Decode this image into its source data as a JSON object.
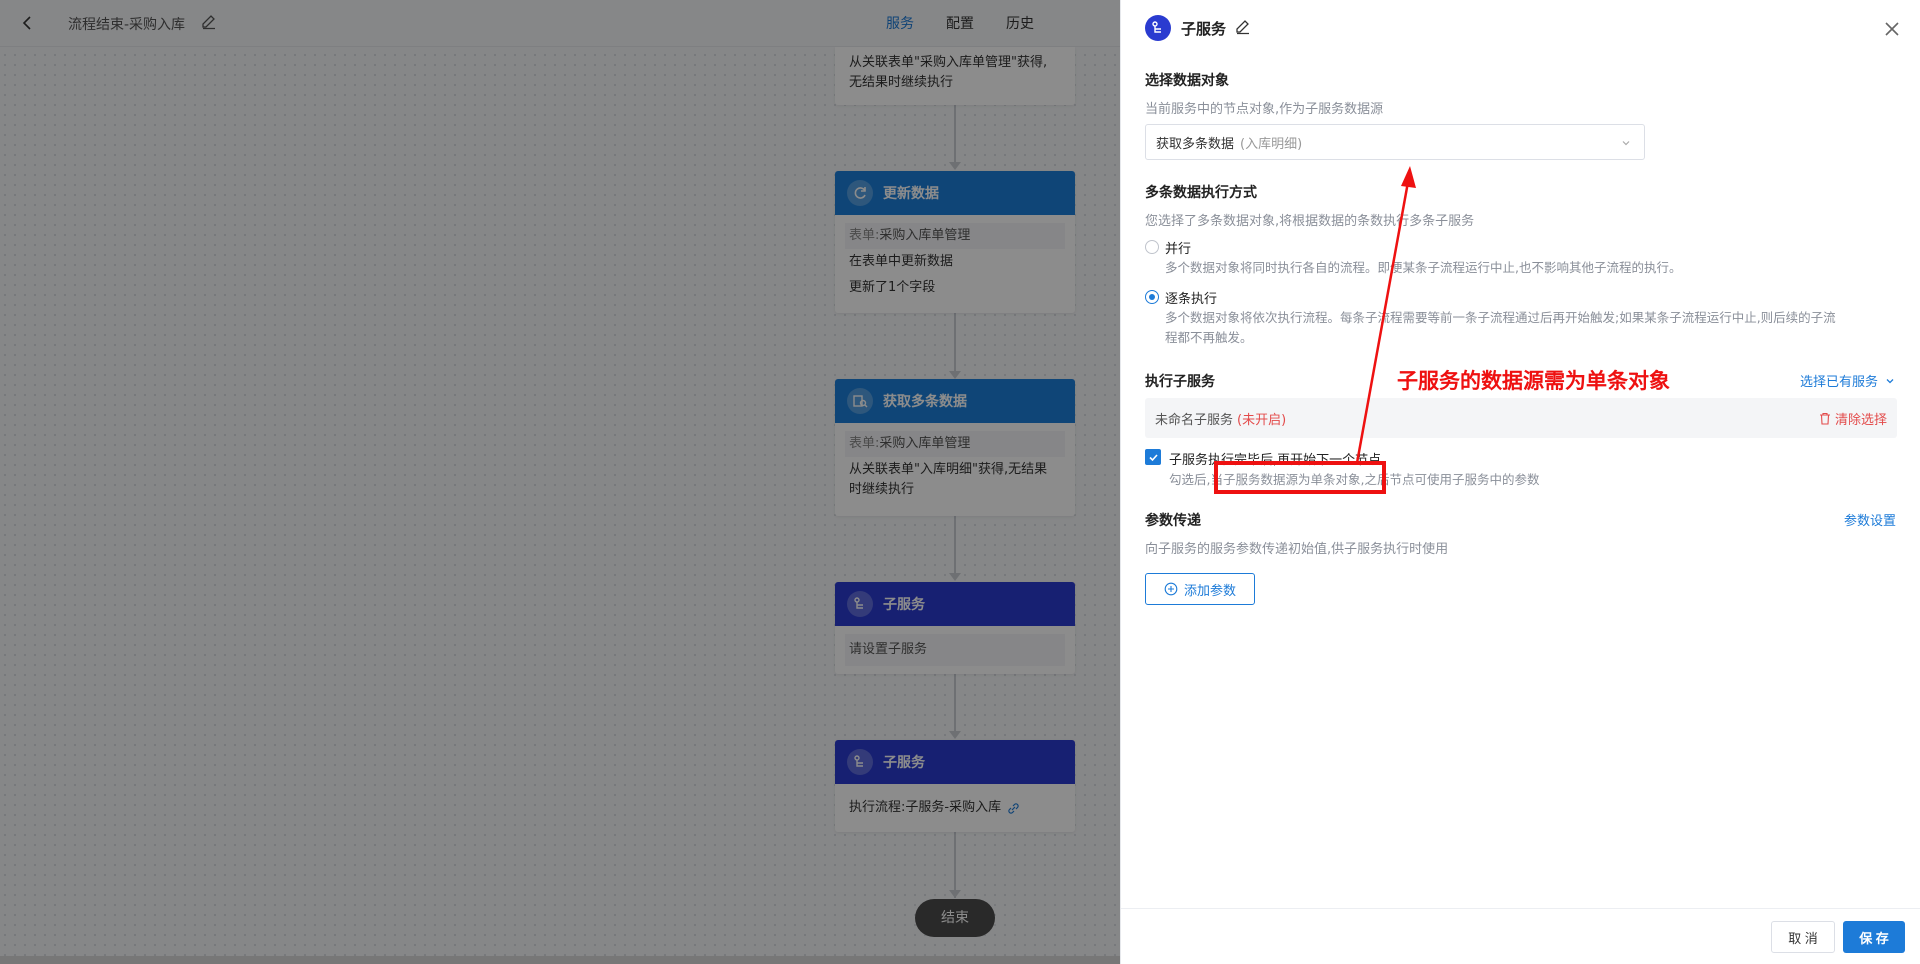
{
  "topbar": {
    "title": "流程结束-采购入库",
    "tabs": [
      {
        "label": "服务",
        "active": true
      },
      {
        "label": "配置",
        "active": false
      },
      {
        "label": "历史",
        "active": false
      }
    ]
  },
  "nodes": {
    "n0": {
      "line1": "从关联表单\"采购入库单管理\"获得,",
      "line2": "无结果时继续执行"
    },
    "n1": {
      "title": "更新数据",
      "form_key": "表单:",
      "form_val": "采购入库单管理",
      "row2": "在表单中更新数据",
      "row3": "更新了1个字段"
    },
    "n2": {
      "title": "获取多条数据",
      "form_key": "表单:",
      "form_val": "采购入库单管理",
      "row2a": "从关联表单\"入库明细\"获得,无结果",
      "row2b": "时继续执行"
    },
    "n3": {
      "title": "子服务",
      "row1": "请设置子服务"
    },
    "n4": {
      "title": "子服务",
      "row1": "执行流程:子服务-采购入库"
    },
    "end": "结束"
  },
  "panel": {
    "title": "子服务",
    "data_object": {
      "title": "选择数据对象",
      "desc": "当前服务中的节点对象,作为子服务数据源",
      "select_value": "获取多条数据",
      "select_sub": "(入库明细)"
    },
    "exec_mode": {
      "title": "多条数据执行方式",
      "desc": "您选择了多条数据对象,将根据数据的条数执行多条子服务",
      "options": [
        {
          "label": "并行",
          "desc": "多个数据对象将同时执行各自的流程。即便某条子流程运行中止,也不影响其他子流程的执行。",
          "checked": false
        },
        {
          "label": "逐条执行",
          "desc1": "多个数据对象将依次执行流程。每条子流程需要等前一条子流程通过后再开始触发;如果某条子流程运行中止,则后续的子流",
          "desc2": "程都不再触发。",
          "checked": true
        }
      ]
    },
    "sub_service": {
      "title": "执行子服务",
      "select_existing": "选择已有服务",
      "name": "未命名子服务",
      "status": "(未开启)",
      "clear": "清除选择",
      "wait_checkbox": {
        "label": "子服务执行完毕后,再开始下一个节点",
        "desc": "勾选后,当子服务数据源为单条对象,之后节点可使用子服务中的参数",
        "checked": true
      }
    },
    "params": {
      "title": "参数传递",
      "settings": "参数设置",
      "desc": "向子服务的服务参数传递初始值,供子服务执行时使用",
      "add_button": "添加参数"
    },
    "footer": {
      "cancel": "取 消",
      "save": "保 存"
    }
  },
  "annotation": {
    "text": "子服务的数据源需为单条对象",
    "color": "#ee1111"
  }
}
